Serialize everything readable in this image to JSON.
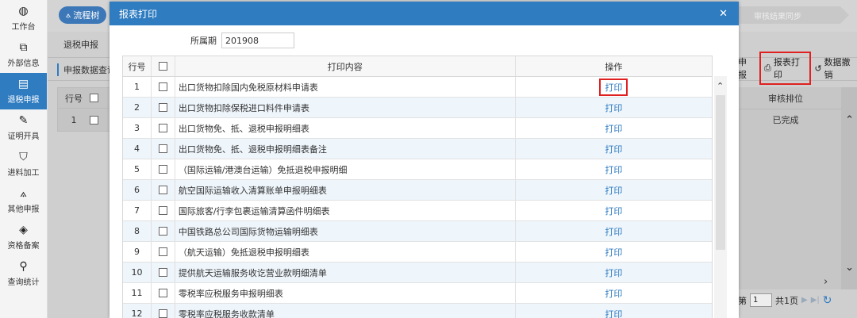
{
  "sidebar": {
    "items": [
      {
        "label": "工作台",
        "icon": "dashboard-icon",
        "glyph": "◍"
      },
      {
        "label": "外部信息",
        "icon": "external-icon",
        "glyph": "⧉"
      },
      {
        "label": "退税申报",
        "icon": "document-icon",
        "glyph": "▤",
        "active": true
      },
      {
        "label": "证明开具",
        "icon": "edit-icon",
        "glyph": "✎"
      },
      {
        "label": "进料加工",
        "icon": "shield-icon",
        "glyph": "⛉"
      },
      {
        "label": "其他申报",
        "icon": "sitemap-icon",
        "glyph": "⟑"
      },
      {
        "label": "资格备案",
        "icon": "cube-icon",
        "glyph": "◈"
      },
      {
        "label": "查询统计",
        "icon": "search-icon",
        "glyph": "⚲"
      }
    ]
  },
  "background": {
    "flow_button": "流程树",
    "sync_step": "审核结果同步",
    "main_tab": "退税申报",
    "query_tab": "申报数据查询",
    "table_header_no": "行号",
    "row_no": "1",
    "toolbar_prefix": "申报",
    "print_button": "报表打印",
    "undo_button": "数据撤销",
    "right_column_header": "审核排位",
    "right_cell": "已完成",
    "pager_prefix": "第",
    "pager_page": "1",
    "pager_total": "共1页"
  },
  "modal": {
    "title": "报表打印",
    "period_label": "所属期",
    "period_value": "201908",
    "headers": {
      "no": "行号",
      "content": "打印内容",
      "action": "操作"
    },
    "rows": [
      {
        "no": "1",
        "content": "出口货物扣除国内免税原材料申请表",
        "action": "打印",
        "highlight": true
      },
      {
        "no": "2",
        "content": "出口货物扣除保税进口料件申请表",
        "action": "打印"
      },
      {
        "no": "3",
        "content": "出口货物免、抵、退税申报明细表",
        "action": "打印"
      },
      {
        "no": "4",
        "content": "出口货物免、抵、退税申报明细表备注",
        "action": "打印"
      },
      {
        "no": "5",
        "content": "（国际运输/港澳台运输）免抵退税申报明细",
        "action": "打印"
      },
      {
        "no": "6",
        "content": "航空国际运输收入清算账单申报明细表",
        "action": "打印"
      },
      {
        "no": "7",
        "content": "国际旅客/行李包裹运输清算函件明细表",
        "action": "打印"
      },
      {
        "no": "8",
        "content": "中国铁路总公司国际货物运输明细表",
        "action": "打印"
      },
      {
        "no": "9",
        "content": "（航天运输）免抵退税申报明细表",
        "action": "打印"
      },
      {
        "no": "10",
        "content": "提供航天运输服务收讫营业款明细清单",
        "action": "打印"
      },
      {
        "no": "11",
        "content": "零税率应税服务申报明细表",
        "action": "打印"
      },
      {
        "no": "12",
        "content": "零税率应税服务收款清单",
        "action": "打印"
      }
    ]
  }
}
